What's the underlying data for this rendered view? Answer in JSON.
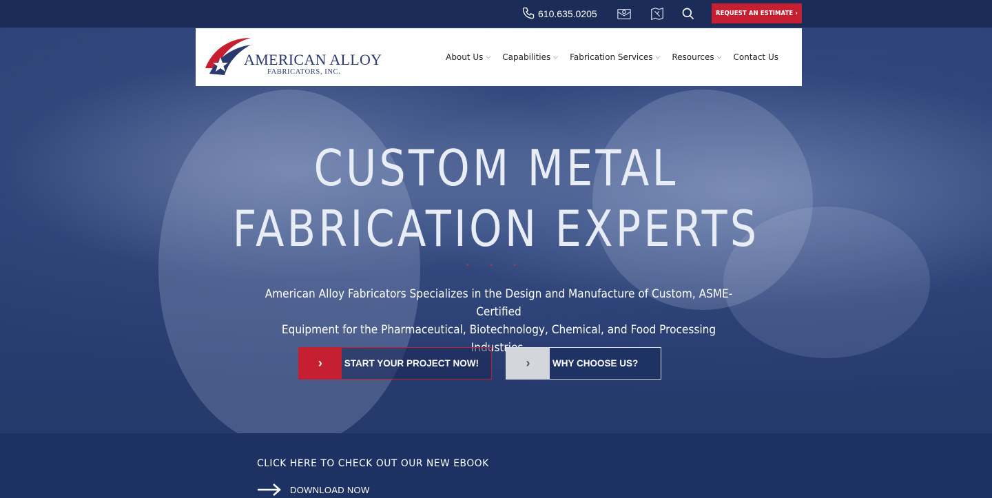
{
  "topbar": {
    "phone": "610.635.0205",
    "estimate_button": "REQUEST AN ESTIMATE ›",
    "icons": [
      "phone-icon",
      "email-icon",
      "map-icon",
      "search-icon"
    ]
  },
  "brand": {
    "name": "AMERICAN ALLOY",
    "sub": "FABRICATORS, INC.",
    "colors": {
      "navy": "#1a2c57",
      "red": "#c61f32",
      "white": "#ffffff"
    }
  },
  "nav": {
    "items": [
      {
        "label": "About Us",
        "has_dropdown": true
      },
      {
        "label": "Capabilities",
        "has_dropdown": true
      },
      {
        "label": "Fabrication Services",
        "has_dropdown": true
      },
      {
        "label": "Resources",
        "has_dropdown": true
      },
      {
        "label": "Contact Us",
        "has_dropdown": false
      }
    ]
  },
  "hero": {
    "headline_line1": "CUSTOM METAL",
    "headline_line2": "FABRICATION EXPERTS",
    "dots": "• • •",
    "subtext_line1": "American Alloy Fabricators Specializes in the Design and Manufacture of Custom, ASME-Certified",
    "subtext_line2": "Equipment for the Pharmaceutical, Biotechnology, Chemical, and Food Processing Industries.",
    "cta_primary": "START YOUR PROJECT NOW!",
    "cta_secondary": "WHY CHOOSE US?"
  },
  "ebook": {
    "title": "CLICK HERE TO CHECK OUT OUR NEW EBOOK",
    "download": "DOWNLOAD NOW"
  }
}
